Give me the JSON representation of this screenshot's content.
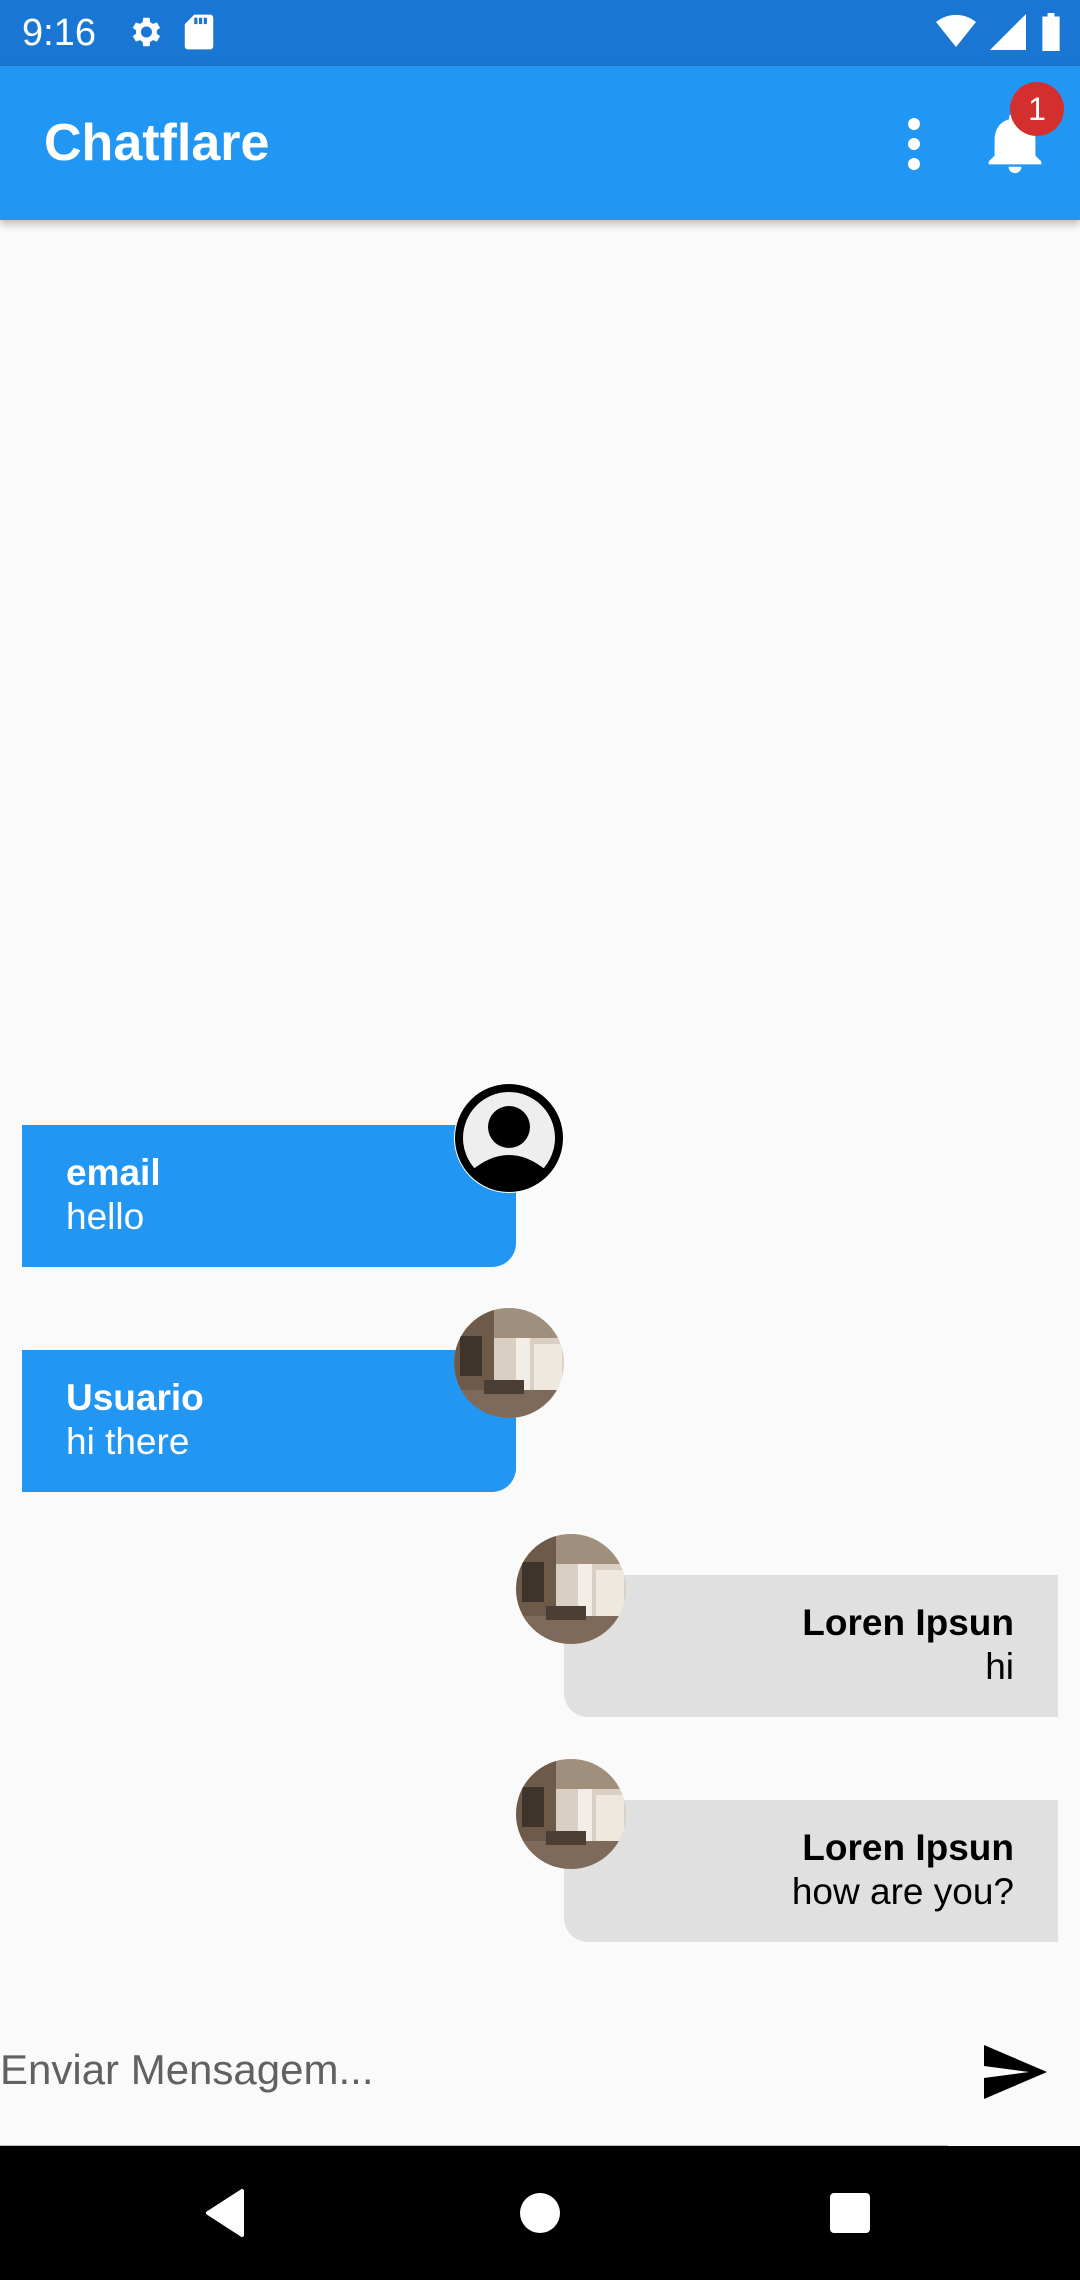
{
  "status_bar": {
    "time": "9:16"
  },
  "app_bar": {
    "title": "Chatflare",
    "notification_count": "1"
  },
  "messages": [
    {
      "sender": "email",
      "text": "hello",
      "side": "left",
      "avatar": "default-avatar-icon"
    },
    {
      "sender": "Usuario",
      "text": "hi there",
      "side": "left",
      "avatar": "room-photo"
    },
    {
      "sender": "Loren Ipsun",
      "text": "hi",
      "side": "right",
      "avatar": "room-photo"
    },
    {
      "sender": "Loren Ipsun",
      "text": "how are you?",
      "side": "right",
      "avatar": "room-photo"
    }
  ],
  "composer": {
    "placeholder": "Enviar Mensagem..."
  },
  "colors": {
    "primary": "#2196f3",
    "status_bar": "#1976d2",
    "incoming_bubble": "#e0e0e0",
    "badge": "#d32f2f"
  }
}
